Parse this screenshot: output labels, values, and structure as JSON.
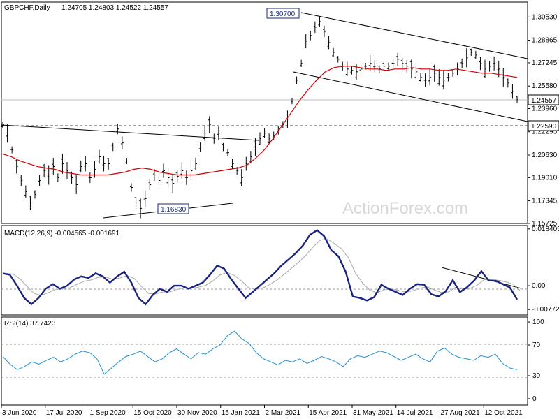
{
  "chart_data": [
    {
      "type": "candlestick",
      "title": "GBPCHF,Daily",
      "ohlc_label": "1.24705 1.24803 1.24522 1.24557",
      "ylim": [
        1.1572,
        1.316
      ],
      "y_ticks": [
        "1.30530",
        "1.28865",
        "1.27245",
        "1.25580",
        "1.23960",
        "1.22295",
        "1.20630",
        "1.19010",
        "1.17345",
        "1.15725"
      ],
      "last_price": "1.24557",
      "level_line": "1.22590",
      "annotations": [
        "1.30700",
        "1.16830"
      ],
      "series": [
        {
          "name": "close",
          "values": [
            1.228,
            1.222,
            1.21,
            1.198,
            1.188,
            1.18,
            1.172,
            1.178,
            1.188,
            1.195,
            1.192,
            1.198,
            1.19,
            1.2,
            1.195,
            1.19,
            1.185,
            1.198,
            1.2,
            1.19,
            1.196,
            1.205,
            1.2,
            1.2,
            1.212,
            1.225,
            1.215,
            1.202,
            1.183,
            1.172,
            1.168,
            1.175,
            1.185,
            1.192,
            1.188,
            1.195,
            1.19,
            1.186,
            1.191,
            1.195,
            1.19,
            1.195,
            1.2,
            1.212,
            1.222,
            1.228,
            1.218,
            1.222,
            1.212,
            1.208,
            1.2,
            1.195,
            1.19,
            1.2,
            1.205,
            1.212,
            1.218,
            1.222,
            1.218,
            1.22,
            1.224,
            1.228,
            1.232,
            1.245,
            1.26,
            1.272,
            1.288,
            1.292,
            1.298,
            1.302,
            1.295,
            1.287,
            1.28,
            1.275,
            1.27,
            1.268,
            1.267,
            1.266,
            1.268,
            1.27,
            1.272,
            1.27,
            1.268,
            1.27,
            1.27,
            1.272,
            1.275,
            1.272,
            1.27,
            1.268,
            1.266,
            1.262,
            1.26,
            1.262,
            1.265,
            1.262,
            1.26,
            1.262,
            1.265,
            1.268,
            1.272,
            1.276,
            1.28,
            1.278,
            1.272,
            1.268,
            1.27,
            1.272,
            1.268,
            1.262,
            1.258,
            1.252,
            1.246
          ]
        },
        {
          "name": "moving average",
          "values": [
            1.207,
            1.205,
            1.202,
            1.2,
            1.198,
            1.197,
            1.196,
            1.194,
            1.193,
            1.192,
            1.192,
            1.192,
            1.192,
            1.193,
            1.194,
            1.196,
            1.197,
            1.196,
            1.194,
            1.193,
            1.192,
            1.192,
            1.192,
            1.193,
            1.194,
            1.195,
            1.196,
            1.197,
            1.199,
            1.204,
            1.21,
            1.218,
            1.227,
            1.236,
            1.245,
            1.253,
            1.26,
            1.266,
            1.269,
            1.27,
            1.27,
            1.269,
            1.268,
            1.268,
            1.267,
            1.268,
            1.268,
            1.269,
            1.268,
            1.268,
            1.267,
            1.267,
            1.268,
            1.267,
            1.266,
            1.265,
            1.265,
            1.264,
            1.263,
            1.262
          ]
        }
      ],
      "x_ticks": [
        "3 Jun 2020",
        "17 Jul 2020",
        "1 Sep 2020",
        "15 Oct 2020",
        "30 Nov 2020",
        "15 Jan 2021",
        "2 Mar 2021",
        "15 Apr 2021",
        "31 May 2021",
        "14 Jul 2021",
        "27 Aug 2021",
        "12 Oct 2021"
      ],
      "watermark": "ActionForex.com"
    },
    {
      "type": "line",
      "title": "MACD(12,26,9) -0.004565 -0.001691",
      "ylim": [
        -0.0095,
        0.0195
      ],
      "y_ticks": [
        "0.018405",
        "0.00",
        "-0.007724"
      ],
      "series": [
        {
          "name": "macd",
          "values": [
            0.004,
            0.0035,
            0.0,
            -0.004,
            -0.006,
            -0.004,
            -0.001,
            0.0005,
            -0.001,
            0.0,
            0.002,
            0.003,
            0.0025,
            0.004,
            0.003,
            0.001,
            0.003,
            0.0045,
            0.001,
            -0.004,
            -0.006,
            -0.003,
            -0.001,
            -0.002,
            0.0,
            0.0,
            -0.001,
            0.0,
            0.001,
            0.0035,
            0.0065,
            0.0055,
            0.002,
            -0.001,
            -0.004,
            -0.002,
            0.0,
            0.002,
            0.004,
            0.0065,
            0.0085,
            0.0105,
            0.013,
            0.0165,
            0.018,
            0.016,
            0.0115,
            0.0095,
            0.0045,
            -0.0035,
            -0.004,
            -0.0048,
            -0.0037,
            0.0003,
            -0.001,
            -0.002,
            -0.003,
            -0.001,
            0.0005,
            0.0003,
            -0.0028,
            -0.0035,
            -0.0018,
            0.0018,
            -0.0021,
            -0.0005,
            0.0017,
            0.0047,
            0.0017,
            0.0016,
            0.0005,
            -0.0006,
            -0.0045
          ]
        }
      ]
    },
    {
      "type": "line",
      "title": "RSI(14) 37.7423",
      "ylim": [
        0,
        100
      ],
      "y_ticks": [
        "100",
        "70",
        "30",
        "0"
      ],
      "series": [
        {
          "name": "rsi",
          "values": [
            55,
            45,
            38,
            42,
            48,
            45,
            50,
            54,
            48,
            52,
            58,
            62,
            60,
            52,
            32,
            40,
            48,
            55,
            58,
            62,
            55,
            48,
            52,
            60,
            65,
            58,
            52,
            60,
            58,
            65,
            70,
            82,
            88,
            78,
            72,
            60,
            52,
            48,
            44,
            50,
            48,
            52,
            46,
            50,
            55,
            52,
            48,
            42,
            52,
            56,
            54,
            58,
            62,
            60,
            55,
            50,
            54,
            58,
            52,
            48,
            62,
            66,
            58,
            54,
            52,
            50,
            56,
            54,
            58,
            46,
            40,
            38
          ]
        }
      ]
    }
  ]
}
